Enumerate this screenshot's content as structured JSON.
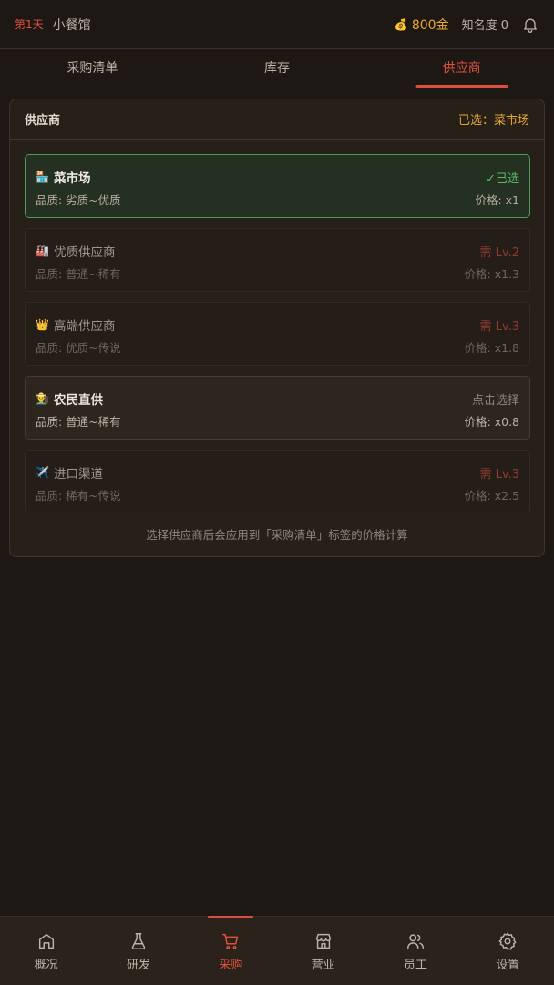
{
  "header": {
    "day": "第1天",
    "shop_name": "小餐馆",
    "gold": "800金",
    "fame": "知名度 0"
  },
  "tabs": [
    {
      "label": "采购清单",
      "active": false
    },
    {
      "label": "库存",
      "active": false
    },
    {
      "label": "供应商",
      "active": true
    }
  ],
  "panel": {
    "title": "供应商",
    "selected_text": "已选：菜市场",
    "note": "选择供应商后会应用到「采购清单」标签的价格计算"
  },
  "suppliers": [
    {
      "emoji": "🏪",
      "name": "菜市场",
      "status": "✓已选",
      "quality": "品质: 劣质~优质",
      "price": "价格: x1",
      "state": "selected"
    },
    {
      "emoji": "🏭",
      "name": "优质供应商",
      "status": "需 Lv.2",
      "quality": "品质: 普通~稀有",
      "price": "价格: x1.3",
      "state": "locked"
    },
    {
      "emoji": "👑",
      "name": "高端供应商",
      "status": "需 Lv.3",
      "quality": "品质: 优质~传说",
      "price": "价格: x1.8",
      "state": "locked"
    },
    {
      "emoji": "👨‍🌾",
      "name": "农民直供",
      "status": "点击选择",
      "quality": "品质: 普通~稀有",
      "price": "价格: x0.8",
      "state": "available"
    },
    {
      "emoji": "✈️",
      "name": "进口渠道",
      "status": "需 Lv.3",
      "quality": "品质: 稀有~传说",
      "price": "价格: x2.5",
      "state": "locked"
    }
  ],
  "nav": [
    {
      "label": "概况",
      "icon": "home-icon",
      "active": false
    },
    {
      "label": "研发",
      "icon": "flask-icon",
      "active": false
    },
    {
      "label": "采购",
      "icon": "cart-icon",
      "active": true
    },
    {
      "label": "营业",
      "icon": "store-icon",
      "active": false
    },
    {
      "label": "员工",
      "icon": "users-icon",
      "active": false
    },
    {
      "label": "设置",
      "icon": "gear-icon",
      "active": false
    }
  ],
  "colors": {
    "accent": "#e0513f",
    "gold": "#e8a735",
    "selected_green": "#5dbb6a",
    "background": "#1e1814"
  }
}
